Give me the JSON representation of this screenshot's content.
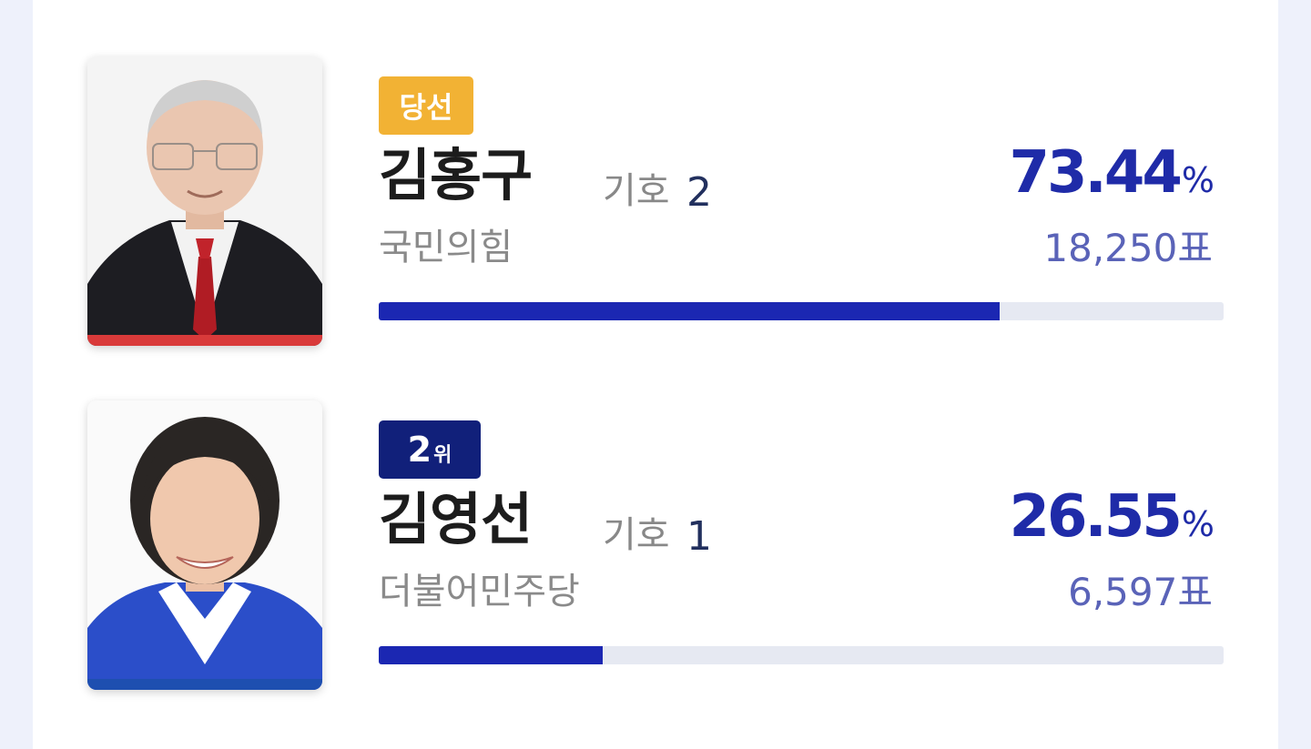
{
  "candidates": [
    {
      "status_badge": "당선",
      "name": "김홍구",
      "number_label": "기호",
      "number": "2",
      "party": "국민의힘",
      "percent": "73.44",
      "percent_unit": "%",
      "votes": "18,250",
      "votes_unit": "표",
      "bar_fraction": 0.7344,
      "party_color": "#d93a3a"
    },
    {
      "rank_number": "2",
      "rank_unit": "위",
      "name": "김영선",
      "number_label": "기호",
      "number": "1",
      "party": "더불어민주당",
      "percent": "26.55",
      "percent_unit": "%",
      "votes": "6,597",
      "votes_unit": "표",
      "bar_fraction": 0.2655,
      "party_color": "#1e4fb0"
    }
  ],
  "colors": {
    "winner_badge": "#f2b234",
    "rank_badge": "#11207a",
    "percent_text": "#1f2ba8",
    "bar_fill": "#1b27b2",
    "bar_track": "#e6e9f2"
  }
}
